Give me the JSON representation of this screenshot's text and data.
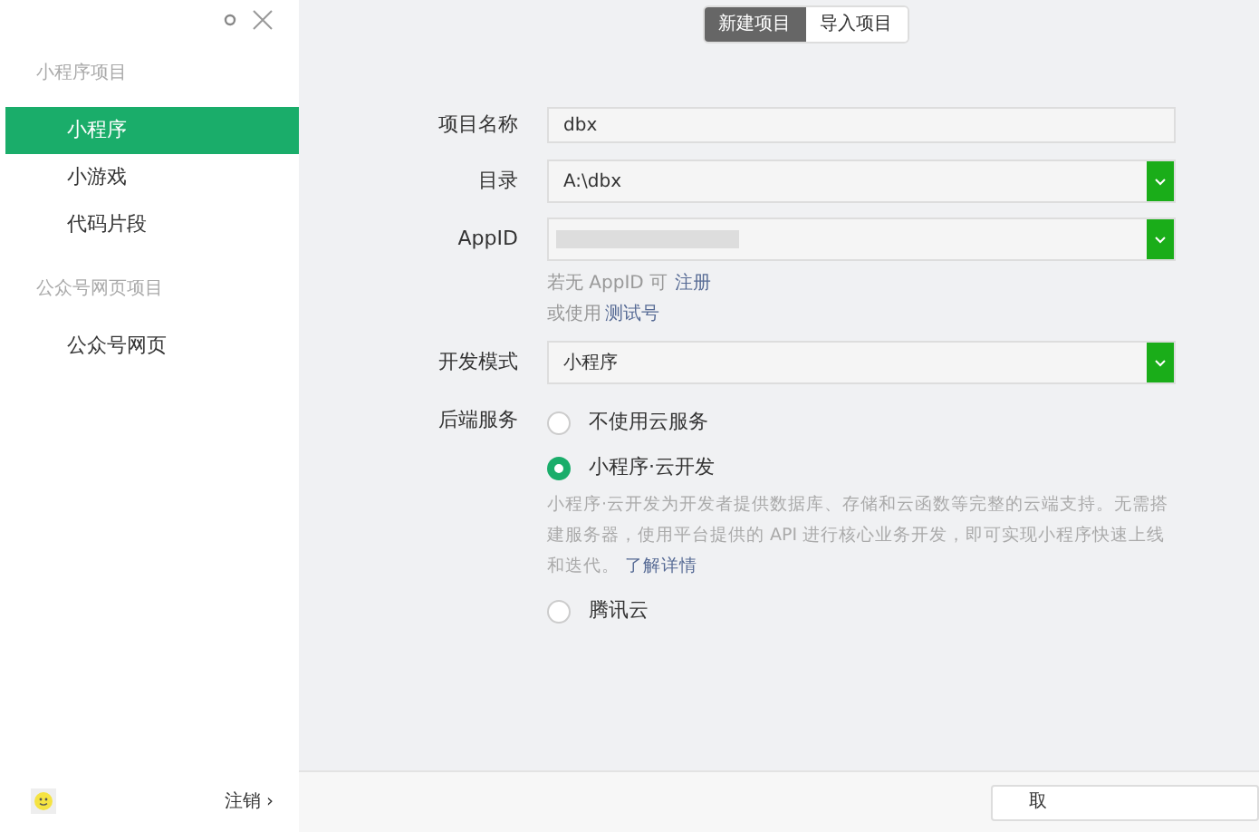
{
  "sidebar": {
    "groups": [
      {
        "title": "小程序项目",
        "items": [
          {
            "label": "小程序",
            "selected": true
          },
          {
            "label": "小游戏",
            "selected": false
          },
          {
            "label": "代码片段",
            "selected": false
          }
        ]
      },
      {
        "title": "公众号网页项目",
        "items": [
          {
            "label": "公众号网页",
            "selected": false
          }
        ]
      }
    ],
    "logout": "注销 ›"
  },
  "tabs": [
    {
      "label": "新建项目",
      "selected": true
    },
    {
      "label": "导入项目",
      "selected": false
    }
  ],
  "form": {
    "name_label": "项目名称",
    "name_value": "dbx",
    "dir_label": "目录",
    "dir_value": "A:\\dbx",
    "appid_label": "AppID",
    "appid_hint": "若无 AppID 可",
    "appid_register": "注册",
    "appid_hint2": "或使用",
    "appid_test": "测试号",
    "mode_label": "开发模式",
    "mode_value": "小程序",
    "backend_label": "后端服务",
    "options": [
      {
        "label": "不使用云服务",
        "selected": false
      },
      {
        "label": "小程序·云开发",
        "selected": true,
        "description": "小程序·云开发为开发者提供数据库、存储和云函数等完整的云端支持。无需搭建服务器，使用平台提供的 API 进行核心业务开发，即可实现小程序快速上线和迭代。",
        "link": "了解详情"
      },
      {
        "label": "腾讯云",
        "selected": false
      }
    ]
  },
  "footer": {
    "button": "取"
  }
}
